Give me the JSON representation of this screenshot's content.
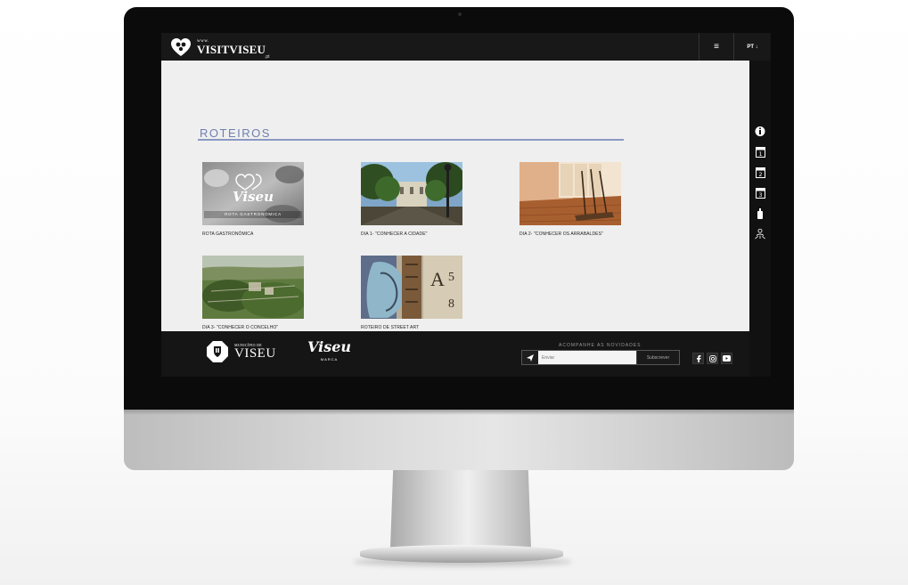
{
  "site": {
    "logo_www": "www.",
    "logo_name": "VISITVISEU",
    "logo_pt": ".pt",
    "menu_icon": "≡",
    "lang_label": "PT ↓"
  },
  "rail_icons": [
    "info-icon",
    "calendar-day1-icon",
    "calendar-day2-icon",
    "calendar-day3-icon",
    "spray-can-icon",
    "people-icon"
  ],
  "page": {
    "title": "ROTEIROS",
    "cards": [
      {
        "caption": "ROTA GASTRONÓMICA",
        "thumb_title": "Viseu",
        "thumb_subtitle": "ROTA GASTRONÓMICA"
      },
      {
        "caption": "DIA 1- \"CONHECER A CIDADE\""
      },
      {
        "caption": "DIA 2- \"CONHECER OS ARRABALDES\""
      },
      {
        "caption": "DIA 3- \"CONHECER O CONCELHO\""
      },
      {
        "caption": "ROTEIRO DE STREET ART"
      }
    ]
  },
  "footer": {
    "municipio_small": "MUNICÍPIO DE",
    "municipio_big": "VISEU",
    "marca_name": "Viseu",
    "marca_sub": "MARCA",
    "newsletter_label": "ACOMPANHE AS NOVIDADES",
    "email_placeholder": "Enviar",
    "subscribe_label": "Subscrever",
    "socials": [
      "facebook-icon",
      "instagram-icon",
      "youtube-icon"
    ]
  },
  "colors": {
    "accent": "#6f7fb0",
    "bar": "#181818",
    "bezel": "#0b0b0b"
  }
}
